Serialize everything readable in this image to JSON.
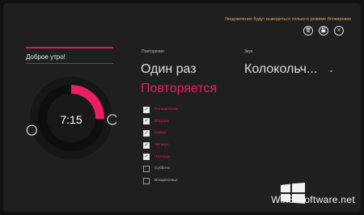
{
  "notice": "Уведомления будут выводиться только в режиме блокировки",
  "actions": [
    {
      "name": "delete",
      "glyph": "🗑"
    },
    {
      "name": "save",
      "glyph": "💾"
    },
    {
      "name": "close",
      "glyph": "✕"
    }
  ],
  "alarm": {
    "name": "Доброе утро!",
    "time": "7:15",
    "dial_filled_fraction": 0.4
  },
  "repeat": {
    "label": "Повторения",
    "once": "Один раз",
    "repeats": "Повторяется",
    "days": [
      {
        "label": "Понедельник",
        "checked": true
      },
      {
        "label": "Вторник",
        "checked": true
      },
      {
        "label": "Среда",
        "checked": true
      },
      {
        "label": "Четверг",
        "checked": true
      },
      {
        "label": "Пятница",
        "checked": true
      },
      {
        "label": "Суббота",
        "checked": false
      },
      {
        "label": "Воскресенье",
        "checked": false
      }
    ]
  },
  "sound": {
    "label": "Звук",
    "value": "Колокольч..."
  },
  "watermark": "Win8-Software.net",
  "colors": {
    "accent": "#e91e63",
    "accent_dark": "#b0104a",
    "background": "#1f1f1f",
    "notice": "#e8a060"
  }
}
